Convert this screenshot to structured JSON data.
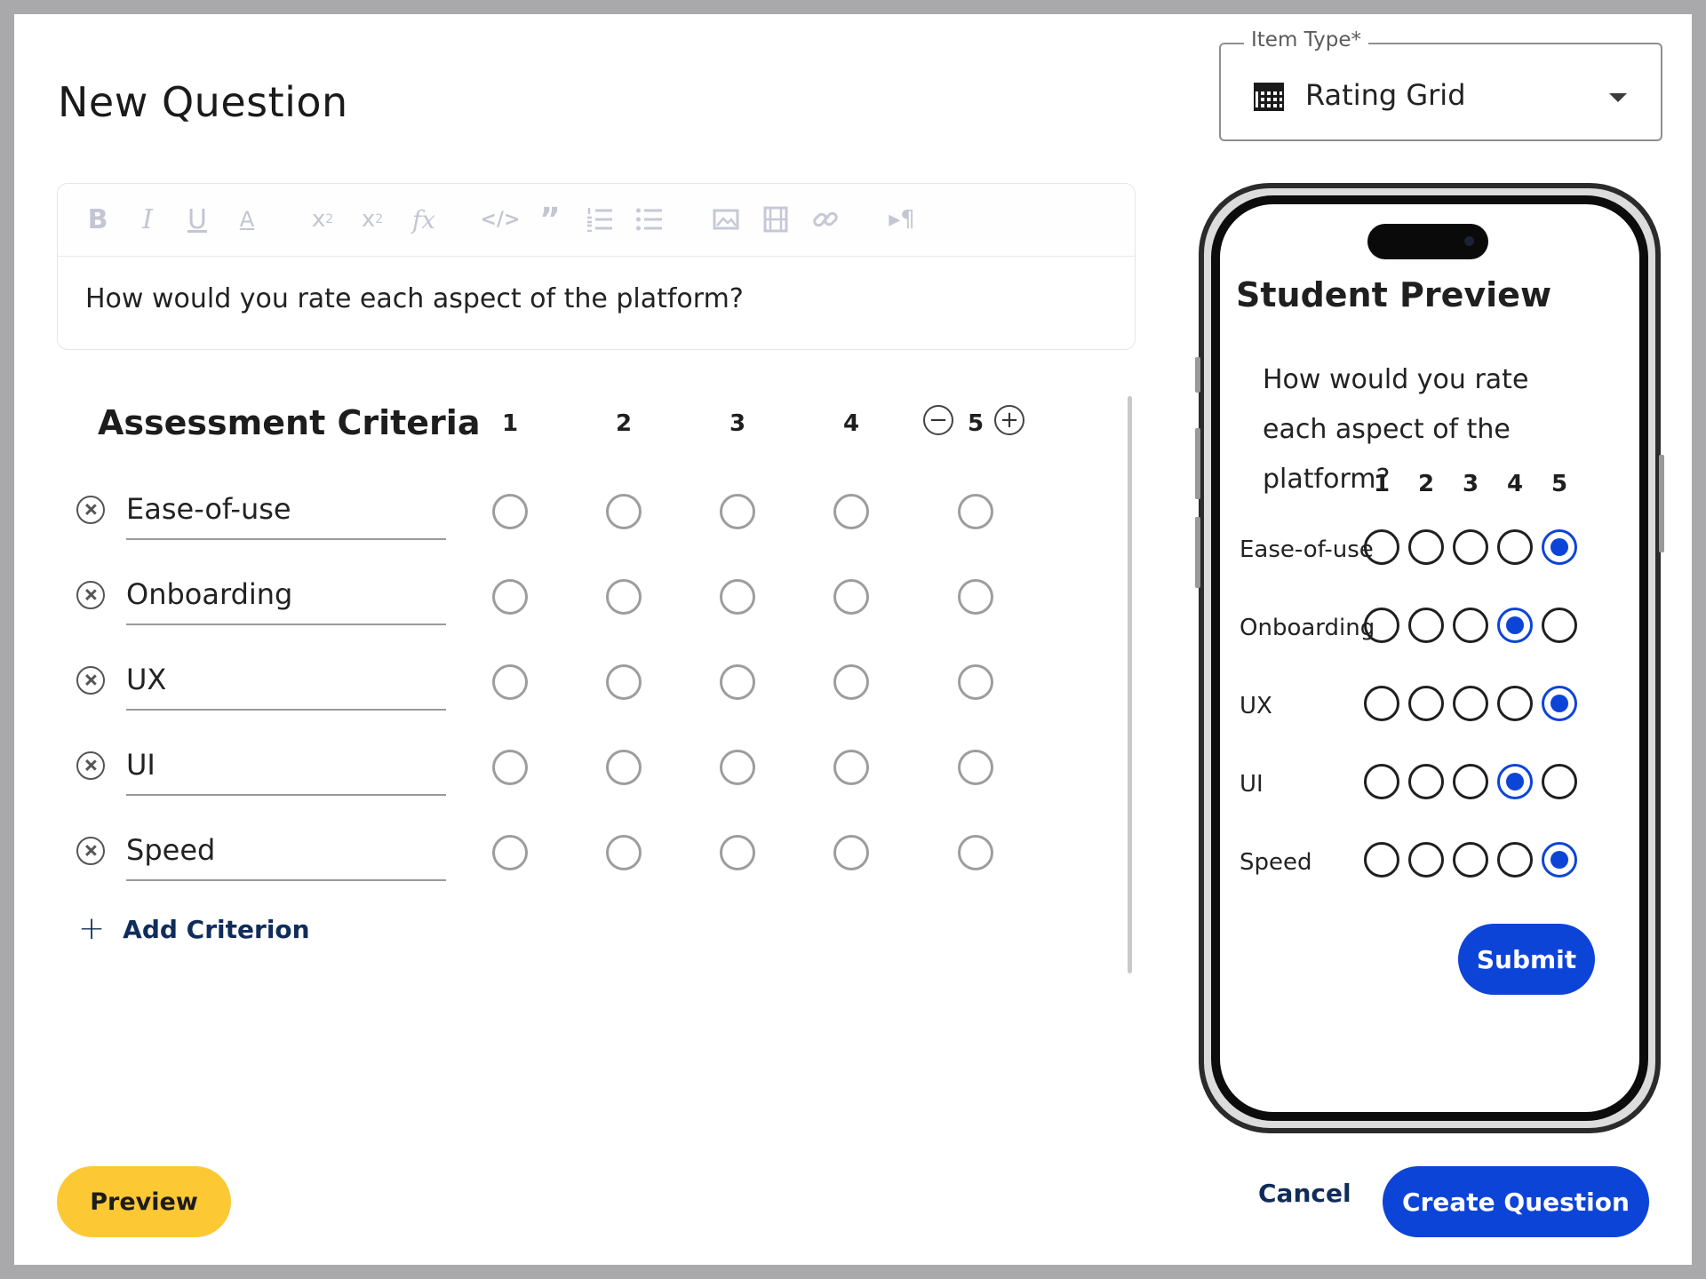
{
  "page": {
    "title": "New Question"
  },
  "item_type": {
    "legend": "Item Type*",
    "value": "Rating Grid",
    "icon": "grid-calendar-icon"
  },
  "toolbar": {
    "icons": [
      "bold-icon",
      "italic-icon",
      "underline-icon",
      "text-color-icon",
      "subscript-icon",
      "superscript-icon",
      "formula-icon",
      "code-icon",
      "quote-icon",
      "ordered-list-icon",
      "bullet-list-icon",
      "image-icon",
      "video-icon",
      "link-icon",
      "paragraph-direction-icon"
    ]
  },
  "editor": {
    "text": "How would you rate each aspect of the platform?"
  },
  "grid": {
    "header": "Assessment Criteria",
    "columns": [
      "1",
      "2",
      "3",
      "4",
      "5"
    ],
    "criteria": [
      "Ease-of-use",
      "Onboarding",
      "UX",
      "UI",
      "Speed"
    ],
    "add_label": "Add Criterion"
  },
  "student_preview": {
    "title": "Student Preview",
    "question": "How would you rate each aspect of the platform?",
    "columns": [
      "1",
      "2",
      "3",
      "4",
      "5"
    ],
    "rows": [
      {
        "label": "Ease-of-use",
        "selected": 5
      },
      {
        "label": "Onboarding",
        "selected": 4
      },
      {
        "label": "UX",
        "selected": 5
      },
      {
        "label": "UI",
        "selected": 4
      },
      {
        "label": "Speed",
        "selected": 5
      }
    ],
    "submit_label": "Submit",
    "accent": "#0d44d8"
  },
  "footer": {
    "preview_label": "Preview",
    "cancel_label": "Cancel",
    "create_label": "Create Question"
  },
  "colors": {
    "primary": "#0d44d8",
    "preview_button": "#fcc935",
    "navy_text": "#0f2c5a"
  }
}
